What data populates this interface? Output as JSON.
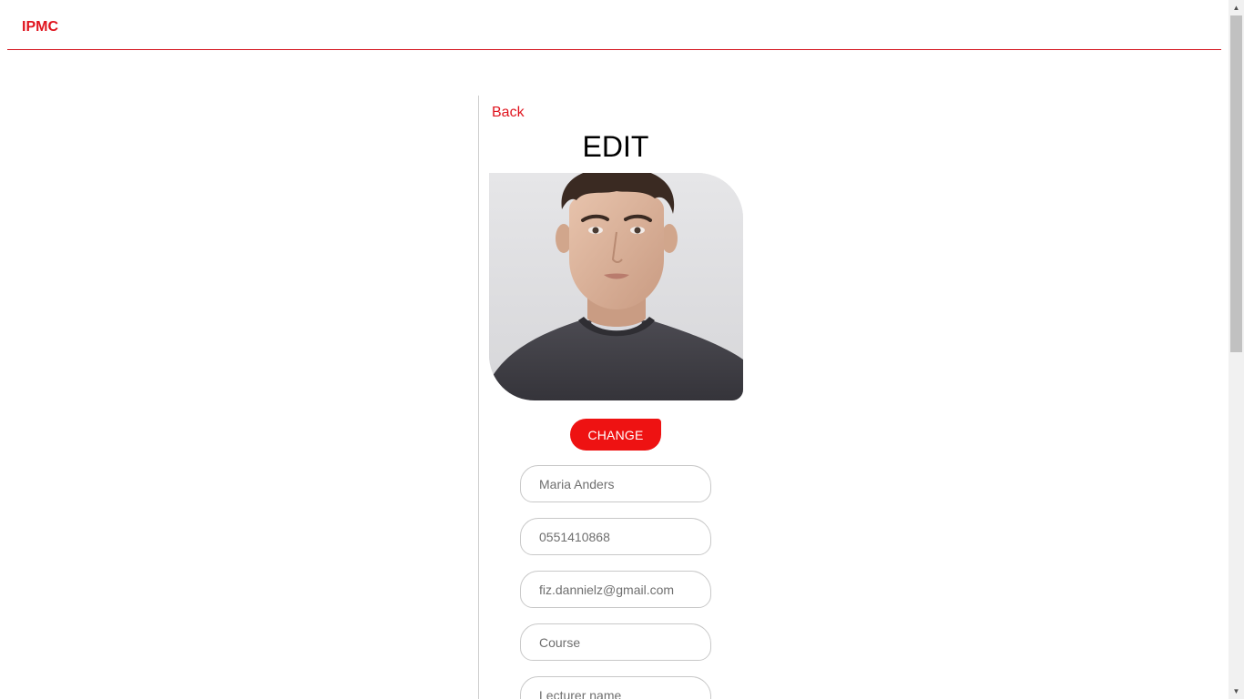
{
  "navbar": {
    "brand": "IPMC",
    "accent_color": "#e0141e"
  },
  "panel": {
    "back_label": "Back",
    "title": "EDIT",
    "avatar_icon": "profile-photo",
    "change_button_label": "CHANGE"
  },
  "form": {
    "fields": [
      {
        "placeholder": "Maria Anders",
        "value": ""
      },
      {
        "placeholder": "0551410868",
        "value": ""
      },
      {
        "placeholder": "fiz.dannielz@gmail.com",
        "value": ""
      },
      {
        "placeholder": "Course",
        "value": ""
      },
      {
        "placeholder": "Lecturer name",
        "value": ""
      }
    ]
  },
  "scrollbar": {
    "up_icon": "triangle-up",
    "down_icon": "triangle-down"
  }
}
